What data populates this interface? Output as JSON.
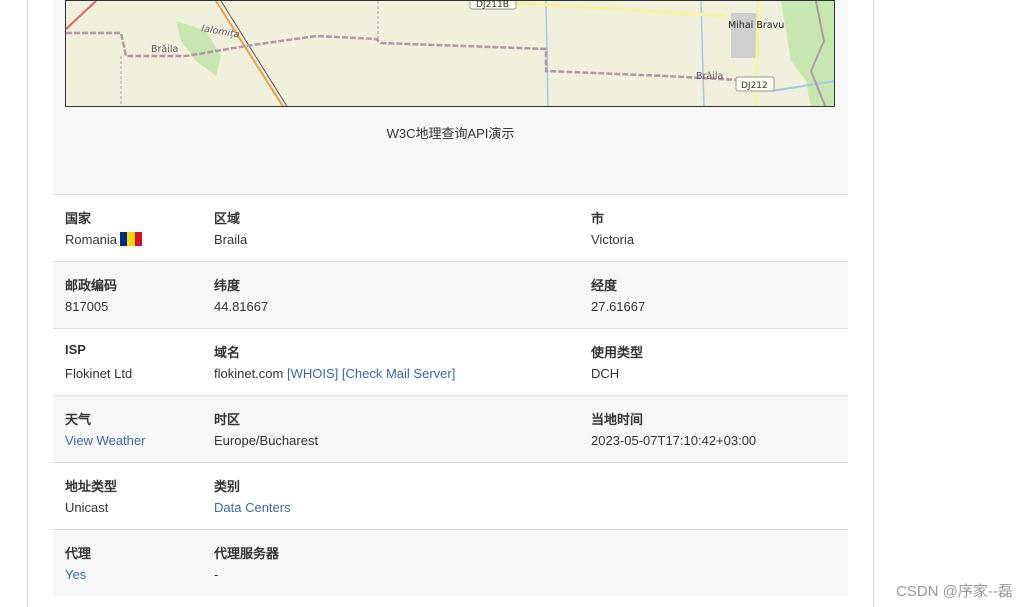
{
  "map": {
    "caption": "W3C地理查询API演示",
    "labels": {
      "braila_left": "Brăila",
      "ialomita": "Ialomița",
      "dj211b": "DJ211B",
      "mihai_bravu": "Mihai Bravu",
      "braila_right": "Brăila",
      "dj212": "DJ212"
    }
  },
  "table": {
    "rows": [
      {
        "c1": {
          "label": "国家",
          "value": "Romania"
        },
        "c2": {
          "label": "区域",
          "value": "Braila"
        },
        "c3": {
          "label": "市",
          "value": "Victoria"
        }
      },
      {
        "c1": {
          "label": "邮政编码",
          "value": "817005"
        },
        "c2": {
          "label": "纬度",
          "value": "44.81667"
        },
        "c3": {
          "label": "经度",
          "value": "27.61667"
        }
      },
      {
        "c1": {
          "label": "ISP",
          "value": "Flokinet Ltd"
        },
        "c2": {
          "label": "域名",
          "value": "flokinet.com",
          "whois": "[WHOIS]",
          "mail": "[Check Mail Server]"
        },
        "c3": {
          "label": "使用类型",
          "value": "DCH"
        }
      },
      {
        "c1": {
          "label": "天气",
          "value": "View Weather"
        },
        "c2": {
          "label": "时区",
          "value": "Europe/Bucharest"
        },
        "c3": {
          "label": "当地时间",
          "value": "2023-05-07T17:10:42+03:00"
        }
      },
      {
        "c1": {
          "label": "地址类型",
          "value": "Unicast"
        },
        "c2": {
          "label": "类别",
          "value": "Data Centers"
        }
      },
      {
        "c1": {
          "label": "代理",
          "value": "Yes"
        },
        "c2": {
          "label": "代理服务器",
          "value": "-"
        }
      }
    ]
  },
  "flag": {
    "name": "romania-flag-icon",
    "colors": [
      "#002B7F",
      "#FCD116",
      "#CE1126"
    ]
  },
  "link_color": "#3b67a8",
  "watermark": "CSDN @序家--磊"
}
